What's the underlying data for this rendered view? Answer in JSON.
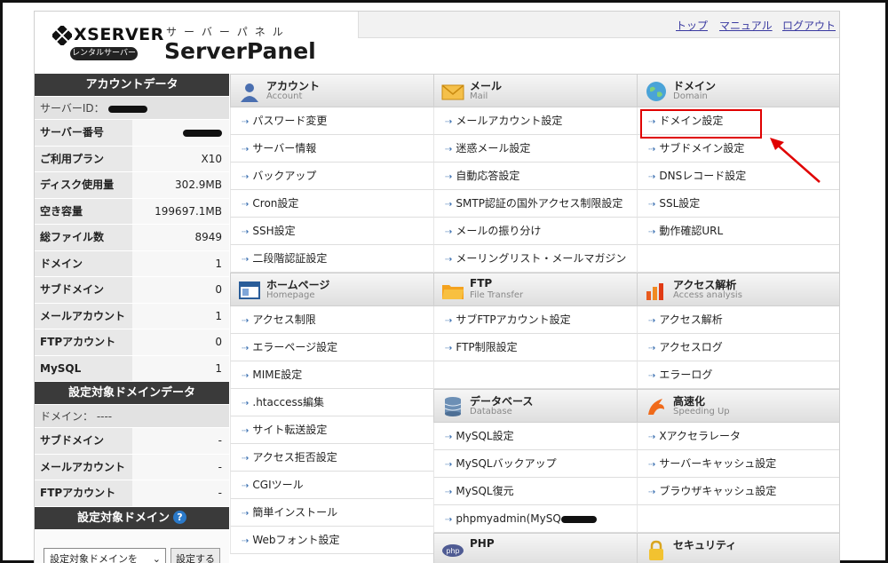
{
  "header": {
    "brand": "XSERVER",
    "badge": "レンタルサーバー",
    "subtitle_kana": "サーバーパネル",
    "title": "ServerPanel"
  },
  "topnav": {
    "top": "トップ",
    "manual": "マニュアル",
    "logout": "ログアウト"
  },
  "account_data": {
    "heading": "アカウントデータ",
    "server_id_label": "サーバーID：",
    "rows": [
      {
        "k": "サーバー番号",
        "v": ""
      },
      {
        "k": "ご利用プラン",
        "v": "X10"
      },
      {
        "k": "ディスク使用量",
        "v": "302.9MB"
      },
      {
        "k": "空き容量",
        "v": "199697.1MB"
      },
      {
        "k": "総ファイル数",
        "v": "8949"
      },
      {
        "k": "ドメイン",
        "v": "1"
      },
      {
        "k": "サブドメイン",
        "v": "0"
      },
      {
        "k": "メールアカウント",
        "v": "1"
      },
      {
        "k": "FTPアカウント",
        "v": "0"
      },
      {
        "k": "MySQL",
        "v": "1"
      }
    ]
  },
  "domain_data": {
    "heading": "設定対象ドメインデータ",
    "domain_label": "ドメイン： ----",
    "rows": [
      {
        "k": "サブドメイン",
        "v": "-"
      },
      {
        "k": "メールアカウント",
        "v": "-"
      },
      {
        "k": "FTPアカウント",
        "v": "-"
      }
    ]
  },
  "target_domain": {
    "heading": "設定対象ドメイン",
    "help": "?",
    "select_value": "設定対象ドメインを",
    "button": "設定する"
  },
  "sections": {
    "account": {
      "jp": "アカウント",
      "en": "Account",
      "items": [
        "パスワード変更",
        "サーバー情報",
        "バックアップ",
        "Cron設定",
        "SSH設定",
        "二段階認証設定"
      ]
    },
    "mail": {
      "jp": "メール",
      "en": "Mail",
      "items": [
        "メールアカウント設定",
        "迷惑メール設定",
        "自動応答設定",
        "SMTP認証の国外アクセス制限設定",
        "メールの振り分け",
        "メーリングリスト・メールマガジン"
      ]
    },
    "domain": {
      "jp": "ドメイン",
      "en": "Domain",
      "items": [
        "ドメイン設定",
        "サブドメイン設定",
        "DNSレコード設定",
        "SSL設定",
        "動作確認URL"
      ]
    },
    "homepage": {
      "jp": "ホームページ",
      "en": "Homepage",
      "items": [
        "アクセス制限",
        "エラーページ設定",
        "MIME設定",
        ".htaccess編集",
        "サイト転送設定",
        "アクセス拒否設定",
        "CGIツール",
        "簡単インストール",
        "Webフォント設定"
      ]
    },
    "ftp": {
      "jp": "FTP",
      "en": "File Transfer",
      "items": [
        "サブFTPアカウント設定",
        "FTP制限設定"
      ]
    },
    "access": {
      "jp": "アクセス解析",
      "en": "Access analysis",
      "items": [
        "アクセス解析",
        "アクセスログ",
        "エラーログ"
      ]
    },
    "database": {
      "jp": "データベース",
      "en": "Database",
      "items": [
        "MySQL設定",
        "MySQLバックアップ",
        "MySQL復元",
        "phpmyadmin(MySQ"
      ]
    },
    "speed": {
      "jp": "高速化",
      "en": "Speeding Up",
      "items": [
        "Xアクセラレータ",
        "サーバーキャッシュ設定",
        "ブラウザキャッシュ設定"
      ]
    },
    "php": {
      "jp": "PHP",
      "en": ""
    },
    "security": {
      "jp": "セキュリティ",
      "en": ""
    }
  },
  "colors": {
    "highlight": "#e00000",
    "link": "#3a3aa0",
    "sidebar_head": "#3a3a3a"
  }
}
